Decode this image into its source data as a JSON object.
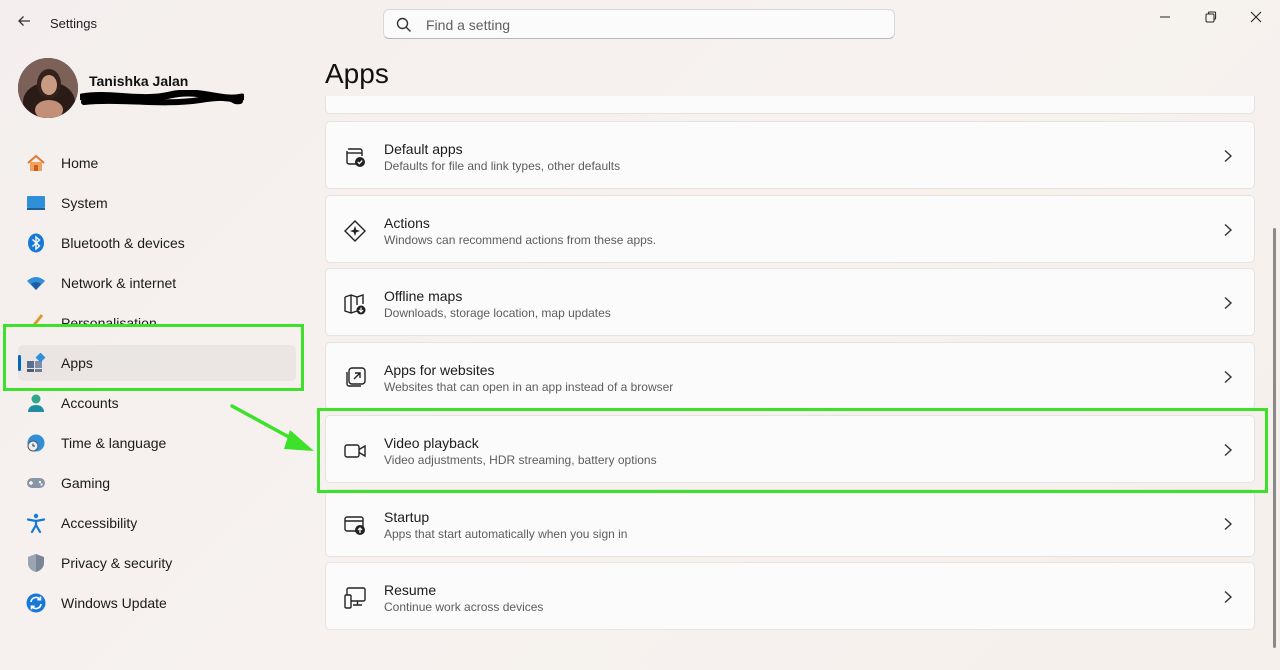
{
  "window": {
    "title": "Settings",
    "search_placeholder": "Find a setting"
  },
  "profile": {
    "name": "Tanishka Jalan"
  },
  "sidebar": {
    "items": [
      {
        "label": "Home",
        "icon": "home-icon"
      },
      {
        "label": "System",
        "icon": "system-icon"
      },
      {
        "label": "Bluetooth & devices",
        "icon": "bluetooth-icon"
      },
      {
        "label": "Network & internet",
        "icon": "wifi-icon"
      },
      {
        "label": "Personalisation",
        "icon": "brush-icon"
      },
      {
        "label": "Apps",
        "icon": "apps-icon",
        "selected": true
      },
      {
        "label": "Accounts",
        "icon": "person-icon"
      },
      {
        "label": "Time & language",
        "icon": "clock-globe-icon"
      },
      {
        "label": "Gaming",
        "icon": "gamepad-icon"
      },
      {
        "label": "Accessibility",
        "icon": "accessibility-icon"
      },
      {
        "label": "Privacy & security",
        "icon": "shield-icon"
      },
      {
        "label": "Windows Update",
        "icon": "update-icon"
      }
    ]
  },
  "main": {
    "title": "Apps",
    "cards": [
      {
        "title": "Default apps",
        "subtitle": "Defaults for file and link types, other defaults",
        "icon": "default-apps-icon"
      },
      {
        "title": "Actions",
        "subtitle": "Windows can recommend actions from these apps.",
        "icon": "actions-icon"
      },
      {
        "title": "Offline maps",
        "subtitle": "Downloads, storage location, map updates",
        "icon": "map-icon"
      },
      {
        "title": "Apps for websites",
        "subtitle": "Websites that can open in an app instead of a browser",
        "icon": "open-external-icon"
      },
      {
        "title": "Video playback",
        "subtitle": "Video adjustments, HDR streaming, battery options",
        "icon": "video-camera-icon"
      },
      {
        "title": "Startup",
        "subtitle": "Apps that start automatically when you sign in",
        "icon": "startup-icon"
      },
      {
        "title": "Resume",
        "subtitle": "Continue work across devices",
        "icon": "devices-icon"
      }
    ]
  },
  "colors": {
    "accent": "#0067c0",
    "annotation_highlight": "#3ee12a"
  }
}
